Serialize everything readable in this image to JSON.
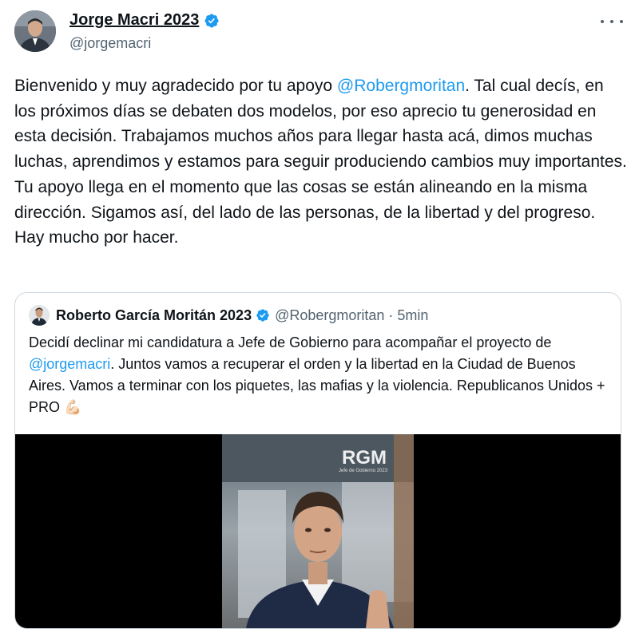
{
  "author": {
    "name": "Jorge Macri 2023",
    "handle": "@jorgemacri"
  },
  "tweet": {
    "part1": "Bienvenido y muy agradecido por tu apoyo ",
    "mention": "@Robergmoritan",
    "part2": ". Tal cual decís, en los próximos días se debaten dos modelos, por eso aprecio tu generosidad en esta decisión. Trabajamos muchos años para llegar hasta acá, dimos muchas luchas, aprendimos y estamos para seguir produciendo cambios muy importantes. Tu apoyo llega en el momento que las cosas se están alineando en la misma dirección. Sigamos  así, del lado de las personas, de la libertad y del progreso. Hay mucho por hacer."
  },
  "quote": {
    "name": "Roberto García Moritán 2023",
    "handle": "@Robergmoritan",
    "separator": "·",
    "time": "5min",
    "text1": "Decidí declinar mi candidatura a Jefe de Gobierno para acompañar el proyecto de ",
    "mention": "@jorgemacri",
    "text2": ". Juntos vamos a recuperar el orden y la libertad en la Ciudad de Buenos Aires. Vamos a terminar con los piquetes, las mafias y la violencia. Republicanos Unidos + PRO 💪🏻"
  },
  "media": {
    "logo": "RGM",
    "logo_sub": "Jefe de Gobierno 2023"
  },
  "icons": {
    "verified": "verified-badge-icon",
    "more": "more-options-icon"
  },
  "colors": {
    "accent": "#1d9bf0",
    "text": "#0f1419",
    "muted": "#536471",
    "border": "#cfd9de"
  }
}
